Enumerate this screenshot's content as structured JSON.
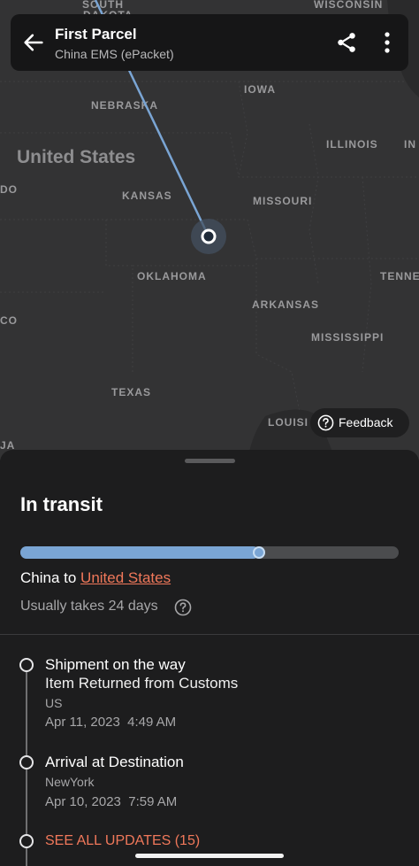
{
  "map": {
    "country_label": "United States",
    "state_labels": [
      "SOUTH",
      "DAKOTA",
      "WISCONSIN",
      "NEBRASKA",
      "IOWA",
      "ILLINOIS",
      "IN",
      "DO",
      "KANSAS",
      "MISSOURI",
      "OKLAHOMA",
      "TENNE",
      "ARKANSAS",
      "CO",
      "MISSISSIPPI",
      "TEXAS",
      "LOUISI",
      "JA"
    ],
    "route_color": "#7aa5d4"
  },
  "header": {
    "title": "First Parcel",
    "subtitle": "China EMS (ePacket)",
    "back_icon": "arrow-left-icon",
    "share_icon": "share-icon",
    "more_icon": "more-vertical-icon"
  },
  "feedback": {
    "label": "Feedback",
    "icon": "question-circle-icon"
  },
  "sheet": {
    "status": "In transit",
    "progress": 0.63,
    "origin": "China",
    "route_connector": " to ",
    "destination": "United States",
    "duration": "Usually takes 24 days",
    "accent_color": "#f0785a"
  },
  "timeline": [
    {
      "title": "Shipment on the way",
      "subtitle": "Item Returned from Customs",
      "location": "US",
      "time": "Apr 11, 2023  4:49 AM"
    },
    {
      "title": "Arrival at Destination",
      "location": "NewYork",
      "time": "Apr 10, 2023  7:59 AM"
    }
  ],
  "see_all": "SEE ALL UPDATES (15)"
}
